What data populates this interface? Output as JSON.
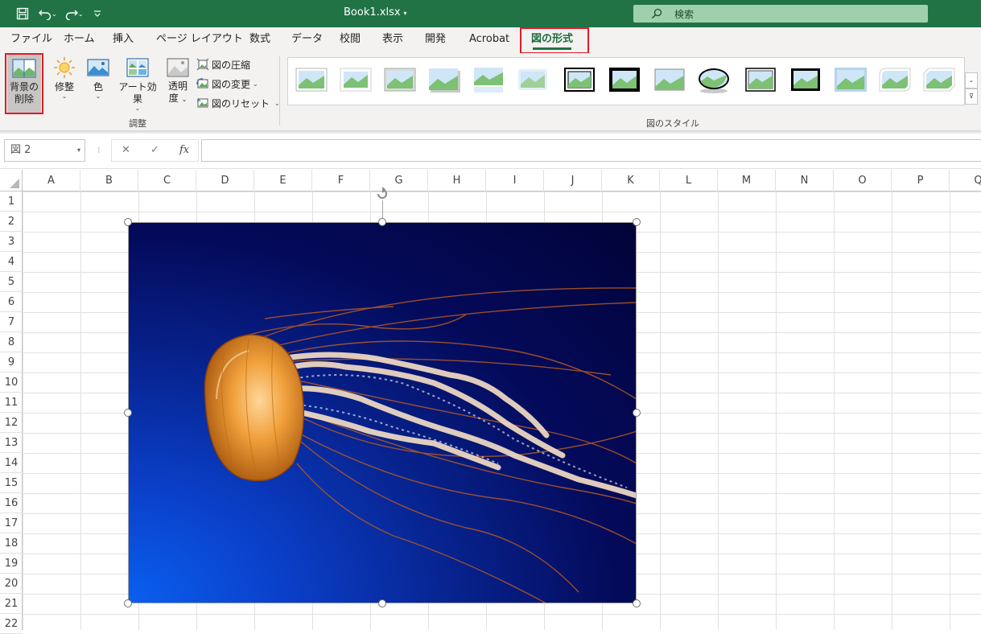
{
  "titlebar": {
    "doc_title": "Book1.xlsx",
    "search_placeholder": "検索"
  },
  "tabs": [
    {
      "label": "ファイル"
    },
    {
      "label": "ホーム"
    },
    {
      "label": "挿入"
    },
    {
      "label": "ページ レイアウト"
    },
    {
      "label": "数式"
    },
    {
      "label": "データ"
    },
    {
      "label": "校閲"
    },
    {
      "label": "表示"
    },
    {
      "label": "開発"
    },
    {
      "label": "Acrobat"
    },
    {
      "label": "図の形式",
      "active": true
    }
  ],
  "ribbon": {
    "adjust": {
      "remove_bg_line1": "背景の",
      "remove_bg_line2": "削除",
      "corrections": "修整",
      "color": "色",
      "artistic": "アート効果",
      "transparency_line1": "透明",
      "transparency_line2": "度",
      "compress": "図の圧縮",
      "change": "図の変更",
      "reset": "図のリセット",
      "group_label": "調整"
    },
    "styles": {
      "group_label": "図のスタイル"
    }
  },
  "formula_bar": {
    "name_box": "図 2",
    "cancel": "✕",
    "enter": "✓",
    "fx": "fx",
    "value": ""
  },
  "grid": {
    "columns": [
      "A",
      "B",
      "C",
      "D",
      "E",
      "F",
      "G",
      "H",
      "I",
      "J",
      "K",
      "L",
      "M",
      "N",
      "O",
      "P",
      "Q"
    ],
    "rows": [
      "1",
      "2",
      "3",
      "4",
      "5",
      "6",
      "7",
      "8",
      "9",
      "10",
      "11",
      "12",
      "13",
      "14",
      "15",
      "16",
      "17",
      "18",
      "19",
      "20",
      "21",
      "22"
    ]
  },
  "picture": {
    "subject": "jellyfish",
    "colors": {
      "bg_light": "#0a5ff0",
      "bg_dark": "#020338",
      "bell": "#e58a1c",
      "tentacles": "#f2dcc4"
    }
  },
  "colors": {
    "accent": "#217346",
    "highlight": "#e01b24"
  }
}
